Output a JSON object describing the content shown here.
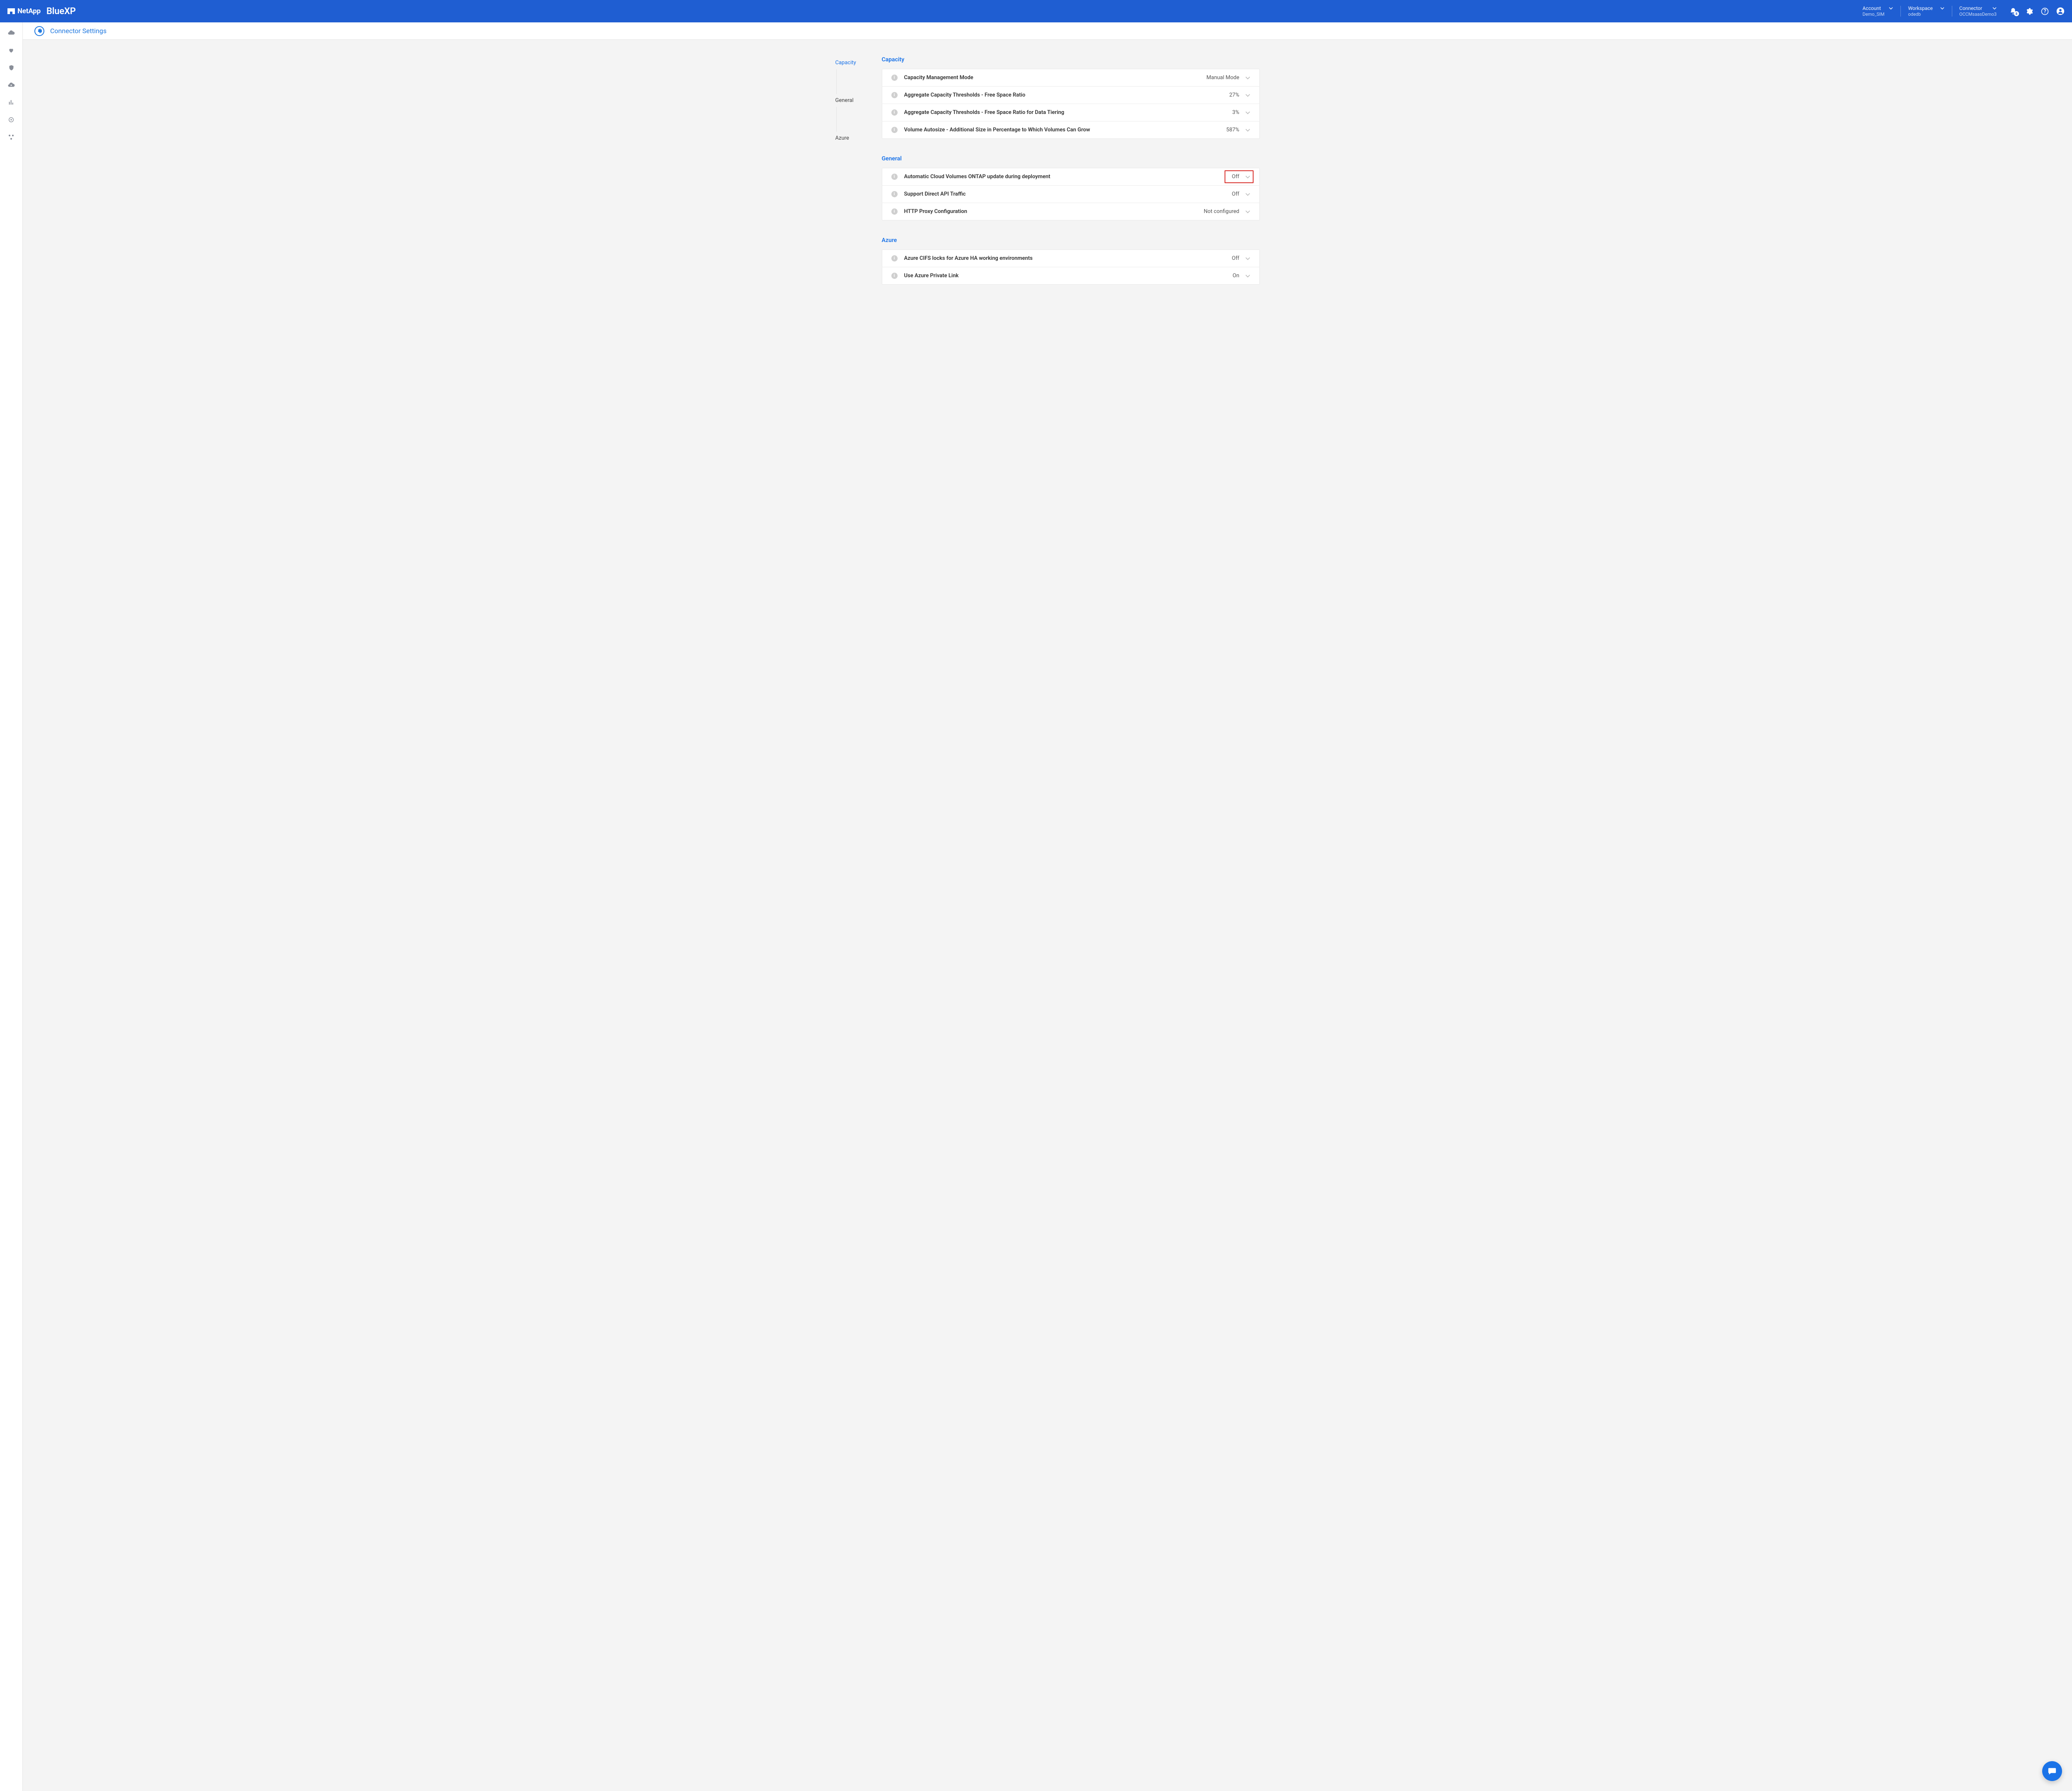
{
  "header": {
    "brand_primary": "NetApp",
    "brand_secondary": "BlueXP",
    "selectors": [
      {
        "label": "Account",
        "value": "Demo_SIM"
      },
      {
        "label": "Workspace",
        "value": "odedb"
      },
      {
        "label": "Connector",
        "value": "OCCMsaasDemo3"
      }
    ],
    "notification_badge": "8"
  },
  "page": {
    "title": "Connector Settings"
  },
  "sidenav": {
    "items": [
      {
        "label": "Capacity",
        "active": true
      },
      {
        "label": "General",
        "active": false
      },
      {
        "label": "Azure",
        "active": false
      }
    ]
  },
  "sections": [
    {
      "key": "capacity",
      "title": "Capacity",
      "rows": [
        {
          "label": "Capacity Management Mode",
          "value": "Manual Mode",
          "highlighted": false
        },
        {
          "label": "Aggregate Capacity Thresholds - Free Space Ratio",
          "value": "27%",
          "highlighted": false
        },
        {
          "label": "Aggregate Capacity Thresholds - Free Space Ratio for Data Tiering",
          "value": "3%",
          "highlighted": false
        },
        {
          "label": "Volume Autosize - Additional Size in Percentage to Which Volumes Can Grow",
          "value": "587%",
          "highlighted": false
        }
      ]
    },
    {
      "key": "general",
      "title": "General",
      "rows": [
        {
          "label": "Automatic Cloud Volumes ONTAP update during deployment",
          "value": "Off",
          "highlighted": true
        },
        {
          "label": "Support Direct API Traffic",
          "value": "Off",
          "highlighted": false
        },
        {
          "label": "HTTP Proxy Configuration",
          "value": "Not configured",
          "highlighted": false
        }
      ]
    },
    {
      "key": "azure",
      "title": "Azure",
      "rows": [
        {
          "label": "Azure CIFS locks for Azure HA working environments",
          "value": "Off",
          "highlighted": false
        },
        {
          "label": "Use Azure Private Link",
          "value": "On",
          "highlighted": false
        }
      ]
    }
  ]
}
